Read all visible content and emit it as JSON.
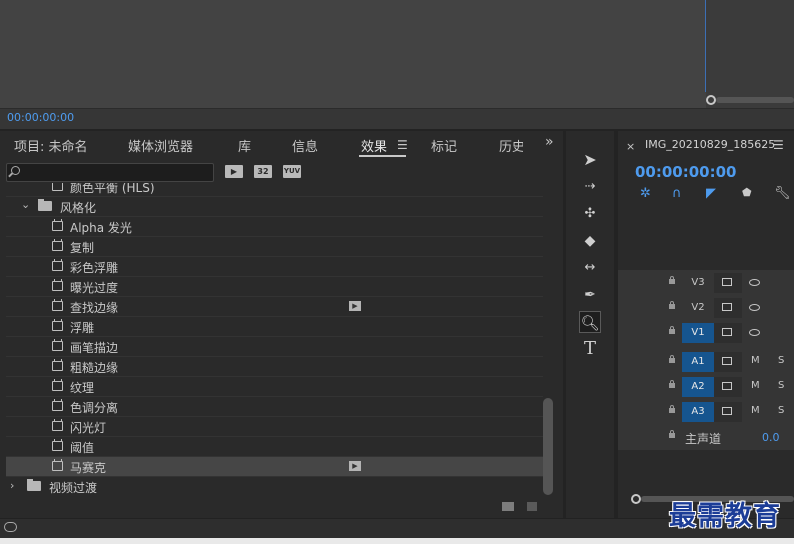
{
  "monitor": {
    "timecode": "00:00:00:00"
  },
  "effects_panel": {
    "tabs": [
      "项目: 未命名",
      "媒体浏览器",
      "库",
      "信息",
      "效果",
      "标记",
      "历史"
    ],
    "active_tab": "效果",
    "search": {
      "value": "",
      "placeholder": ""
    },
    "filter_badges": [
      "32",
      "YUV"
    ],
    "rows": [
      {
        "label": "颜色平衡 (HLS)",
        "kind": "effect",
        "indent": 2,
        "partial": true
      },
      {
        "label": "风格化",
        "kind": "folder",
        "indent": 1,
        "expanded": true
      },
      {
        "label": "Alpha 发光",
        "kind": "effect",
        "indent": 2
      },
      {
        "label": "复制",
        "kind": "effect",
        "indent": 2
      },
      {
        "label": "彩色浮雕",
        "kind": "effect",
        "indent": 2
      },
      {
        "label": "曝光过度",
        "kind": "effect",
        "indent": 2
      },
      {
        "label": "查找边缘",
        "kind": "effect",
        "indent": 2,
        "accelerated": true
      },
      {
        "label": "浮雕",
        "kind": "effect",
        "indent": 2
      },
      {
        "label": "画笔描边",
        "kind": "effect",
        "indent": 2
      },
      {
        "label": "粗糙边缘",
        "kind": "effect",
        "indent": 2
      },
      {
        "label": "纹理",
        "kind": "effect",
        "indent": 2
      },
      {
        "label": "色调分离",
        "kind": "effect",
        "indent": 2
      },
      {
        "label": "闪光灯",
        "kind": "effect",
        "indent": 2
      },
      {
        "label": "阈值",
        "kind": "effect",
        "indent": 2
      },
      {
        "label": "马赛克",
        "kind": "effect",
        "indent": 2,
        "accelerated": true,
        "selected": true
      },
      {
        "label": "视频过渡",
        "kind": "folder",
        "indent": 0,
        "expanded": false
      }
    ]
  },
  "tools": [
    "selection-tool",
    "track-select-tool",
    "ripple-edit-tool",
    "razor-tool",
    "slip-tool",
    "pen-tool",
    "zoom-tool",
    "type-tool"
  ],
  "selected_tool": "zoom-tool",
  "timeline": {
    "sequence_name": "IMG_20210829_185625",
    "timecode": "00:00:00:00",
    "video_tracks": [
      {
        "name": "V3",
        "targeted": false
      },
      {
        "name": "V2",
        "targeted": false
      },
      {
        "name": "V1",
        "targeted": true
      }
    ],
    "audio_tracks": [
      {
        "name": "A1",
        "targeted": true,
        "m": "M",
        "s": "S"
      },
      {
        "name": "A2",
        "targeted": true,
        "m": "M",
        "s": "S"
      },
      {
        "name": "A3",
        "targeted": true,
        "m": "M",
        "s": "S"
      }
    ],
    "master": {
      "label": "主声道",
      "value": "0.0"
    }
  },
  "watermark": "最需教育",
  "colors": {
    "accent_blue": "#4e9bee",
    "track_target_blue": "#16558f",
    "panel_bg": "#2a2a2a"
  }
}
